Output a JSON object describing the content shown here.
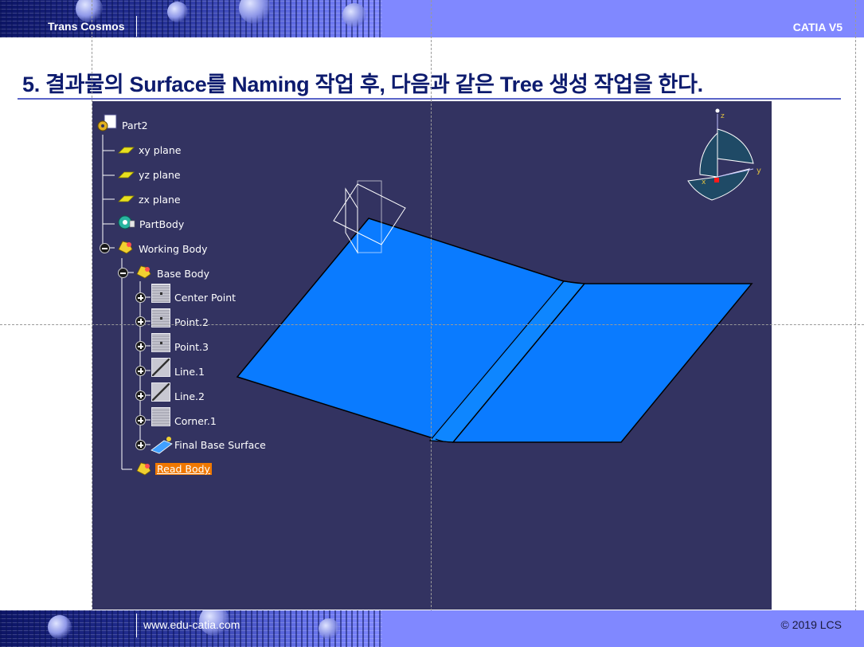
{
  "header": {
    "left": "Trans Cosmos",
    "right": "CATIA V5"
  },
  "title": "5. 결과물의 Surface를 Naming 작업 후, 다음과 같은 Tree 생성 작업을 한다.",
  "footer": {
    "left": "www.edu-catia.com",
    "right": "© 2019 LCS"
  },
  "tree": {
    "root": "Part2",
    "items": [
      "xy plane",
      "yz plane",
      "zx plane",
      "PartBody",
      "Working Body",
      "Base Body",
      "Center Point",
      "Point.2",
      "Point.3",
      "Line.1",
      "Line.2",
      "Corner.1",
      "Final Base Surface",
      "Read Body"
    ],
    "selected": "Read Body"
  },
  "compass": {
    "x": "x",
    "y": "y",
    "z": "z"
  },
  "colors": {
    "background": "#333361",
    "surface": "#0a7bff",
    "selection": "#f07800",
    "band": "#8088ff"
  }
}
